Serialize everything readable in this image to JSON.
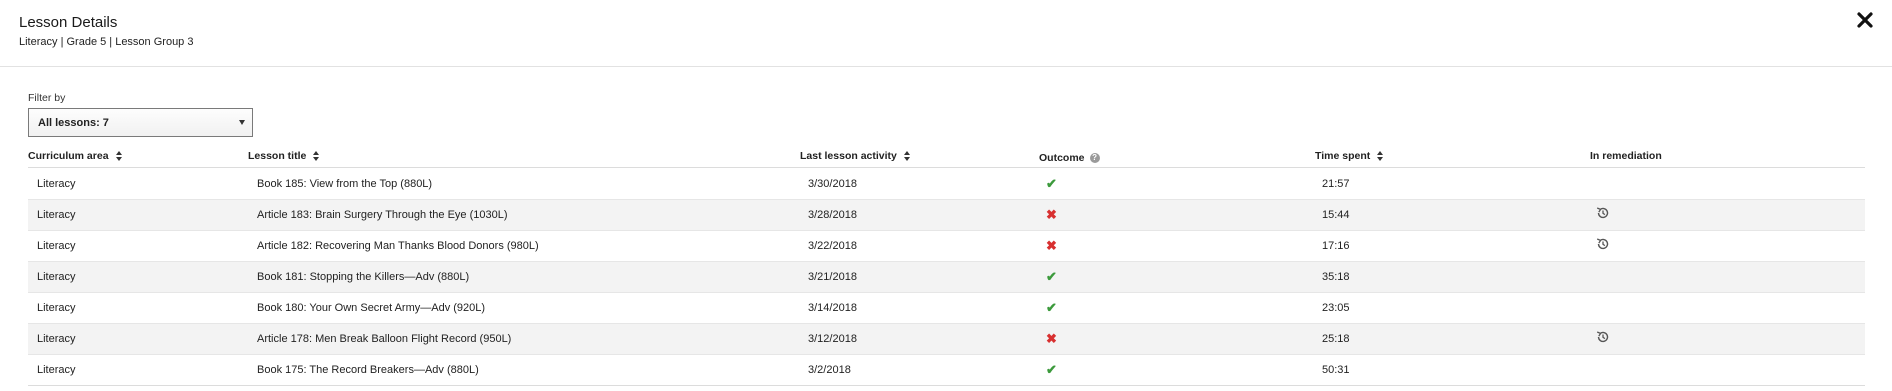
{
  "dialog": {
    "title": "Lesson Details",
    "subtitle": "Literacy | Grade 5 | Lesson Group 3",
    "close_icon": "close-icon"
  },
  "filter": {
    "label": "Filter by",
    "selected": "All lessons: 7"
  },
  "columns": {
    "curriculum_area": "Curriculum area",
    "lesson_title": "Lesson title",
    "last_activity": "Last lesson activity",
    "outcome": "Outcome",
    "time_spent": "Time spent",
    "in_remediation": "In remediation"
  },
  "colors": {
    "pass": "#3c9a3c",
    "fail": "#d83030",
    "row_alt": "#f3f3f3"
  },
  "rows": [
    {
      "area": "Literacy",
      "title": "Book 185: View from the Top (880L)",
      "date": "3/30/2018",
      "outcome": "pass",
      "outcome_icon": "✔",
      "time": "21:57",
      "remediation": false
    },
    {
      "area": "Literacy",
      "title": "Article 183: Brain Surgery Through the Eye (1030L)",
      "date": "3/28/2018",
      "outcome": "fail",
      "outcome_icon": "✖",
      "time": "15:44",
      "remediation": true
    },
    {
      "area": "Literacy",
      "title": "Article 182: Recovering Man Thanks Blood Donors (980L)",
      "date": "3/22/2018",
      "outcome": "fail",
      "outcome_icon": "✖",
      "time": "17:16",
      "remediation": true
    },
    {
      "area": "Literacy",
      "title": "Book 181: Stopping the Killers—Adv (880L)",
      "date": "3/21/2018",
      "outcome": "pass",
      "outcome_icon": "✔",
      "time": "35:18",
      "remediation": false
    },
    {
      "area": "Literacy",
      "title": "Book 180: Your Own Secret Army—Adv (920L)",
      "date": "3/14/2018",
      "outcome": "pass",
      "outcome_icon": "✔",
      "time": "23:05",
      "remediation": false
    },
    {
      "area": "Literacy",
      "title": "Article 178: Men Break Balloon Flight Record (950L)",
      "date": "3/12/2018",
      "outcome": "fail",
      "outcome_icon": "✖",
      "time": "25:18",
      "remediation": true
    },
    {
      "area": "Literacy",
      "title": "Book 175: The Record Breakers—Adv (880L)",
      "date": "3/2/2018",
      "outcome": "pass",
      "outcome_icon": "✔",
      "time": "50:31",
      "remediation": false
    }
  ]
}
